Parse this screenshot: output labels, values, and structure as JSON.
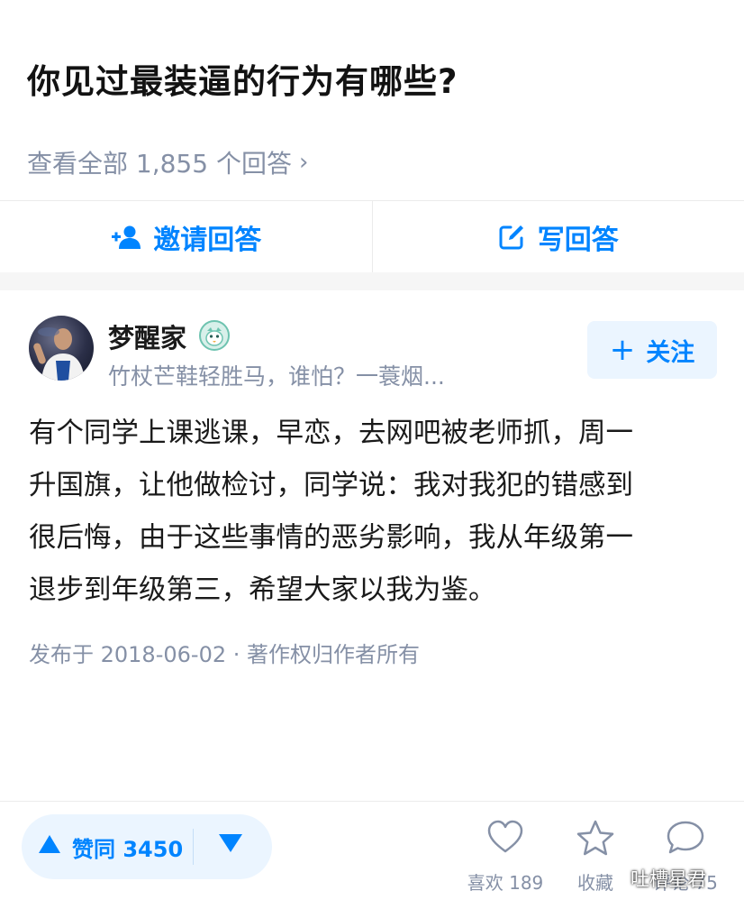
{
  "question": {
    "title": "你见过最装逼的行为有哪些?",
    "view_all": "查看全部 1,855 个回答"
  },
  "actions": {
    "invite_label": "邀请回答",
    "write_label": "写回答"
  },
  "author": {
    "name": "梦醒家",
    "bio": "竹杖芒鞋轻胜马，谁怕？一蓑烟...",
    "follow_label": "关注"
  },
  "answer": {
    "lines": [
      "有个同学上课逃课，早恋，去网吧被老师抓，周一",
      "升国旗，让他做检讨，同学说：我对我犯的错感到",
      "很后悔，由于这些事情的恶劣影响，我从年级第一",
      "退步到年级第三，希望大家以我为鉴。"
    ],
    "publish_info": "发布于 2018-06-02 · 著作权归作者所有"
  },
  "bottom": {
    "vote_label": "赞同 3450",
    "like_label": "喜欢 189",
    "collect_label": "收藏",
    "comment_label": "评论 75",
    "watermark": "吐槽星君"
  },
  "colors": {
    "accent": "#0084ff",
    "muted": "#8590a6"
  }
}
